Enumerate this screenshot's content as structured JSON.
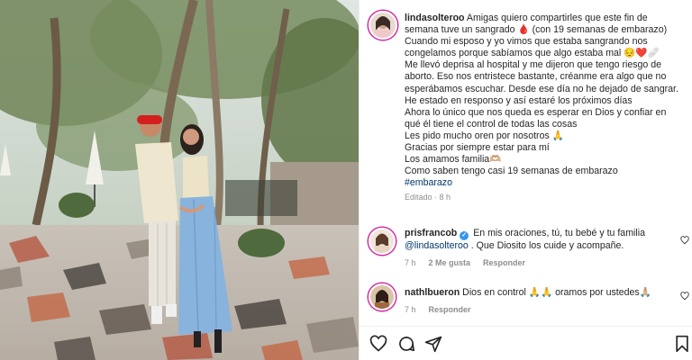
{
  "post": {
    "username": "lindasolteroo",
    "caption_lines": [
      "Amigas quiero compartirles que este fin de",
      "semana tuve un sangrado 🩸 (con 19 semanas de embarazo)",
      "Cuando mi esposo y yo vimos que estaba sangrando nos",
      "congelamos porque sabíamos que algo estaba mal 😔❤️🩹",
      "Me llevó deprisa al hospital y me dijeron que tengo riesgo de",
      "aborto. Eso nos entristece bastante, créanme era algo que no",
      "esperábamos escuchar. Desde ese día no he dejado de sangrar.",
      "He estado en responso y así estaré los próximos días",
      "Ahora lo único que nos queda es esperar en Dios y confiar en",
      "qué él tiene el control de todas las cosas",
      "Les pido mucho oren por nosotros 🙏",
      "Gracias por siempre estar para mí",
      "Los amamos familia🫶🏼",
      "Como saben tengo casi 19 semanas de embarazo"
    ],
    "hashtag": "#embarazo",
    "edited": "Editado · 8 h"
  },
  "comments": [
    {
      "username": "prisfrancob",
      "text": "En mis oraciones, tú, tu bebé y tu familia",
      "mention": "@lindasolteroo",
      "text2": ". Que Diosito los cuide y acompañe.",
      "time": "7 h",
      "likes": "2 Me gusta",
      "reply": "Responder"
    },
    {
      "username": "nathlbueron",
      "text": "Dios en control 🙏🙏 oramos por ustedes🙏🏼",
      "time": "7 h",
      "reply": "Responder"
    }
  ],
  "icons": {
    "like": "heart-icon",
    "comment": "comment-icon",
    "share": "share-icon",
    "save": "bookmark-icon"
  }
}
